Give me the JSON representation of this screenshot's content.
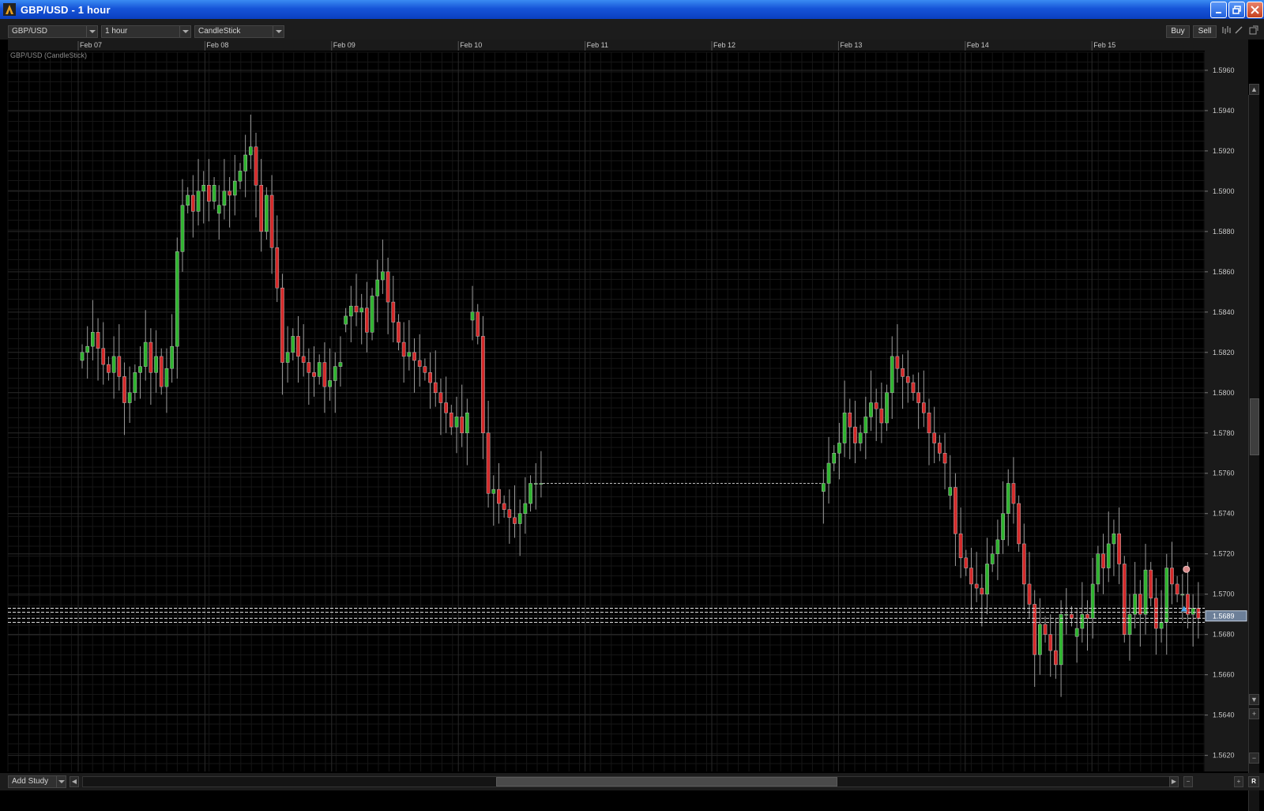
{
  "window": {
    "title": "GBP/USD - 1 hour",
    "buttons": [
      "minimize",
      "restore",
      "close"
    ]
  },
  "toolbar": {
    "symbol": "GBP/USD",
    "interval": "1 hour",
    "chart_type": "CandleStick",
    "buy_label": "Buy",
    "sell_label": "Sell",
    "icons": [
      "bars-icon",
      "pen-icon",
      "popout-icon"
    ]
  },
  "chart": {
    "series_label": "GBP/USD (CandleStick)",
    "last_price": "1.5689",
    "colors": {
      "up": "#2fb42f",
      "down": "#d42a2a",
      "grid": "#2a2a2a",
      "axis_text": "#c8c8c8",
      "background": "#000000"
    }
  },
  "chart_data": {
    "type": "candlestick",
    "title": "GBP/USD (CandleStick)",
    "x_axis_labels": [
      "Feb 07",
      "Feb 08",
      "Feb 09",
      "Feb 10",
      "Feb 11",
      "Feb 12",
      "Feb 13",
      "Feb 14",
      "Feb 15"
    ],
    "y_axis_ticks": [
      "1.5960",
      "1.5940",
      "1.5920",
      "1.5900",
      "1.5880",
      "1.5860",
      "1.5840",
      "1.5820",
      "1.5800",
      "1.5780",
      "1.5760",
      "1.5740",
      "1.5720",
      "1.5700",
      "1.5680",
      "1.5660",
      "1.5640",
      "1.5620"
    ],
    "ylim": [
      1.5612,
      1.5969
    ],
    "grid": true,
    "last_price": 1.5689,
    "reference_levels": [
      1.5693,
      1.5691,
      1.5688,
      1.5686
    ],
    "gap_line": {
      "from_day": "Feb 10",
      "to_day": "Feb 12",
      "price": 1.5755
    },
    "segments": [
      {
        "start_day_offset": 0.0,
        "hours": 26,
        "prices": [
          1.582,
          1.5823,
          1.583,
          1.5822,
          1.5814,
          1.581,
          1.5818,
          1.5808,
          1.5795,
          1.58,
          1.581,
          1.5813,
          1.5825,
          1.581,
          1.5818,
          1.5803,
          1.5812,
          1.5823,
          1.587,
          1.5893,
          1.5898,
          1.589,
          1.59,
          1.5903,
          1.5895,
          1.5903
        ]
      },
      {
        "start_day_offset": 1.08,
        "hours": 24,
        "prices": [
          1.5893,
          1.59,
          1.5898,
          1.5905,
          1.591,
          1.5918,
          1.5922,
          1.5903,
          1.588,
          1.5898,
          1.5872,
          1.5852,
          1.5815,
          1.582,
          1.5828,
          1.5818,
          1.5815,
          1.581,
          1.5808,
          1.5815,
          1.5803,
          1.5806,
          1.5813,
          1.5815
        ]
      },
      {
        "start_day_offset": 2.08,
        "hours": 24,
        "prices": [
          1.5838,
          1.5843,
          1.584,
          1.5842,
          1.583,
          1.5848,
          1.5856,
          1.586,
          1.5845,
          1.5835,
          1.5825,
          1.5818,
          1.582,
          1.5816,
          1.5813,
          1.581,
          1.5805,
          1.58,
          1.5795,
          1.579,
          1.5783,
          1.5788,
          1.578,
          1.579
        ]
      },
      {
        "start_day_offset": 3.08,
        "hours": 14,
        "prices": [
          1.584,
          1.5828,
          1.578,
          1.575,
          1.5752,
          1.5745,
          1.5742,
          1.5738,
          1.5735,
          1.574,
          1.5745,
          1.5755,
          1.5755,
          1.5755
        ]
      },
      {
        "start_day_offset": 5.85,
        "hours": 24,
        "prices": [
          1.5755,
          1.5765,
          1.577,
          1.5775,
          1.579,
          1.5783,
          1.5775,
          1.578,
          1.5788,
          1.5795,
          1.5792,
          1.5785,
          1.58,
          1.5818,
          1.5812,
          1.5808,
          1.5805,
          1.58,
          1.5795,
          1.579,
          1.578,
          1.5775,
          1.577,
          1.5765
        ]
      },
      {
        "start_day_offset": 6.85,
        "hours": 24,
        "prices": [
          1.5753,
          1.573,
          1.5718,
          1.5713,
          1.5705,
          1.5703,
          1.57,
          1.5715,
          1.572,
          1.5727,
          1.574,
          1.5755,
          1.5745,
          1.5725,
          1.5705,
          1.5695,
          1.567,
          1.5685,
          1.568,
          1.5672,
          1.5665,
          1.569,
          1.569,
          1.5688
        ]
      },
      {
        "start_day_offset": 7.85,
        "hours": 24,
        "prices": [
          1.5683,
          1.569,
          1.5688,
          1.5705,
          1.572,
          1.5713,
          1.5725,
          1.573,
          1.5715,
          1.568,
          1.569,
          1.57,
          1.569,
          1.5712,
          1.5698,
          1.5683,
          1.5686,
          1.5713,
          1.5705,
          1.57,
          1.57,
          1.569,
          1.5693,
          1.5688
        ]
      }
    ],
    "markers": [
      {
        "type": "sell-dot",
        "price": 1.571
      },
      {
        "type": "buy-triangle",
        "price": 1.5693
      }
    ]
  },
  "bottombar": {
    "add_study_label": "Add Study"
  }
}
